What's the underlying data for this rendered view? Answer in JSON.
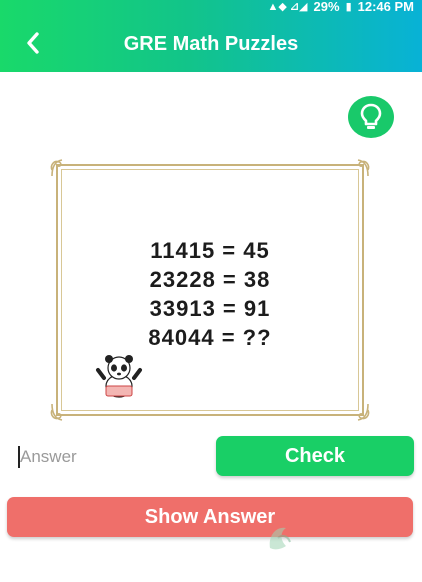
{
  "status_bar": {
    "battery": "29%",
    "time": "12:46 PM"
  },
  "header": {
    "title": "GRE Math Puzzles"
  },
  "puzzle": {
    "lines": [
      "11415 = 45",
      "23228 = 38",
      "33913 = 91",
      "84044 = ??"
    ]
  },
  "answer_field": {
    "placeholder": "Answer",
    "value": ""
  },
  "check_button": {
    "label": "Check"
  },
  "show_answer_button": {
    "label": "Show Answer"
  },
  "watermark": {
    "text": "豌豆荚"
  },
  "colors": {
    "header_start": "#19d96a",
    "header_end": "#08b2d6",
    "accent_green": "#19cf66",
    "show_answer_red": "#ef6f6a",
    "frame_gold": "#c8b27a"
  }
}
